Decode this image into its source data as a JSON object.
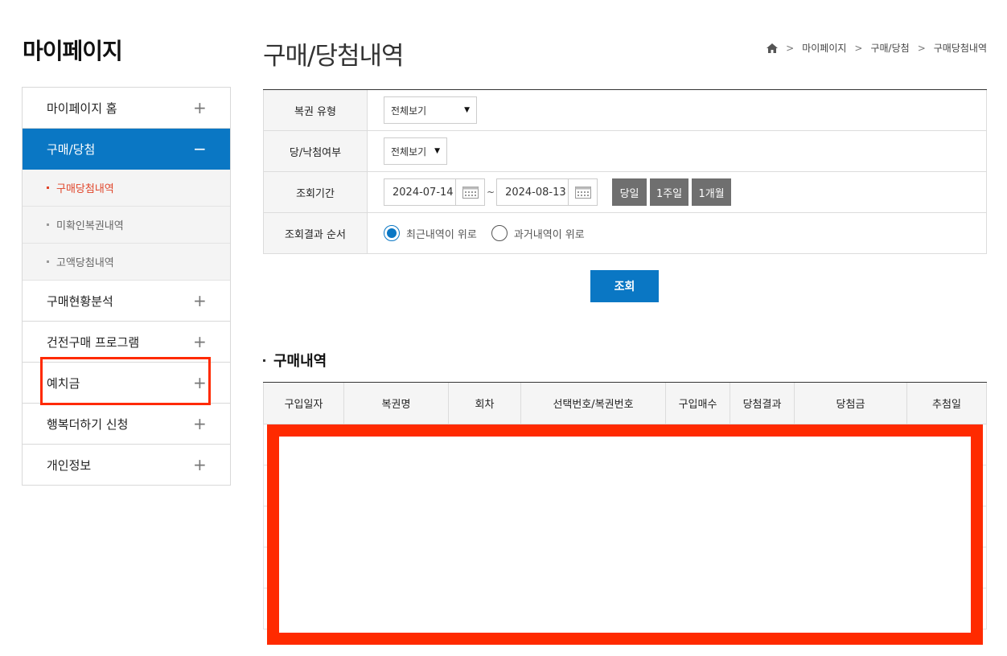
{
  "sidebar": {
    "title": "마이페이지",
    "items": [
      {
        "label": "마이페이지 홈",
        "toggle": "+"
      },
      {
        "label": "구매/당첨",
        "toggle": "−"
      },
      {
        "label": "구매현황분석",
        "toggle": "+"
      },
      {
        "label": "건전구매 프로그램",
        "toggle": "+"
      },
      {
        "label": "예치금",
        "toggle": "+"
      },
      {
        "label": "행복더하기 신청",
        "toggle": "+"
      },
      {
        "label": "개인정보",
        "toggle": "+"
      }
    ],
    "sub_items": [
      {
        "label": "구매당첨내역"
      },
      {
        "label": "미확인복권내역"
      },
      {
        "label": "고액당첨내역"
      }
    ]
  },
  "header": {
    "title": "구매/당첨내역",
    "breadcrumb": [
      "마이페이지",
      "구매/당첨",
      "구매당첨내역"
    ]
  },
  "form": {
    "lottery_type_label": "복권 유형",
    "lottery_type_value": "전체보기",
    "win_status_label": "당/낙첨여부",
    "win_status_value": "전체보기",
    "period_label": "조회기간",
    "date_from": "2024-07-14",
    "date_sep": "~",
    "date_to": "2024-08-13",
    "period_buttons": [
      "당일",
      "1주일",
      "1개월"
    ],
    "order_label": "조회결과 순서",
    "order_options": [
      "최근내역이 위로",
      "과거내역이 위로"
    ],
    "search_label": "조회"
  },
  "results": {
    "title": "구매내역",
    "columns": [
      "구입일자",
      "복권명",
      "회차",
      "선택번호/복권번호",
      "구입매수",
      "당첨결과",
      "당첨금",
      "추첨일"
    ]
  },
  "colors": {
    "accent": "#0a77c4",
    "highlight": "#ff2a00",
    "current": "#e0452a"
  }
}
